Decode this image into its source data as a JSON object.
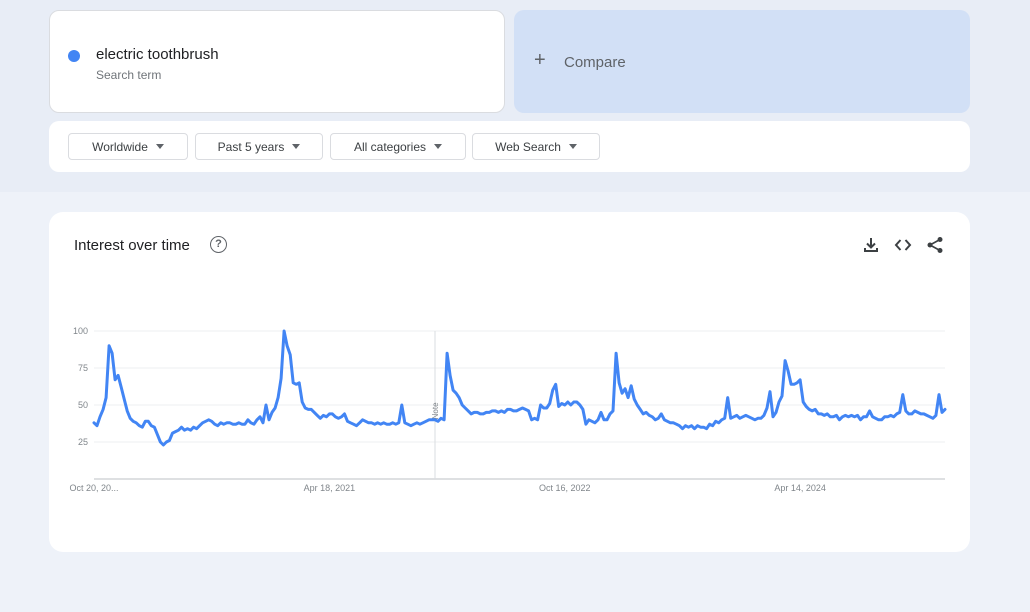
{
  "search": {
    "term": "electric toothbrush",
    "term_sublabel": "Search term",
    "term_color": "#4285f4",
    "compare_icon": "plus-icon",
    "compare_label": "Compare"
  },
  "filters": [
    {
      "label": "Worldwide"
    },
    {
      "label": "Past 5 years"
    },
    {
      "label": "All categories"
    },
    {
      "label": "Web Search"
    }
  ],
  "chart_card": {
    "title": "Interest over time",
    "help_icon": "help-circle-icon",
    "tools": [
      "download-icon",
      "embed-code-icon",
      "share-icon"
    ]
  },
  "chart_data": {
    "type": "line",
    "title": "",
    "xlabel": "",
    "ylabel": "",
    "ylim": [
      0,
      100
    ],
    "yticks": [
      25,
      50,
      75,
      100
    ],
    "xtick_labels": [
      "Oct 20, 20...",
      "Apr 18, 2021",
      "Oct 16, 2022",
      "Apr 14, 2024"
    ],
    "xtick_indices": [
      0,
      78,
      156,
      234
    ],
    "note_label": "Note",
    "note_index": 113,
    "grid": true,
    "series": [
      {
        "color": "#4285f4",
        "values": [
          38,
          36,
          42,
          47,
          55,
          90,
          85,
          67,
          70,
          62,
          54,
          46,
          41,
          39,
          38,
          36,
          35,
          39,
          39,
          36,
          35,
          30,
          25,
          23,
          25,
          26,
          31,
          32,
          33,
          35,
          33,
          34,
          33,
          35,
          34,
          36,
          38,
          39,
          40,
          39,
          37,
          36,
          38,
          37,
          38,
          38,
          37,
          37,
          38,
          37,
          37,
          40,
          38,
          37,
          40,
          42,
          38,
          50,
          40,
          45,
          48,
          55,
          68,
          100,
          90,
          84,
          65,
          64,
          65,
          52,
          48,
          47,
          47,
          45,
          43,
          41,
          43,
          42,
          44,
          44,
          42,
          41,
          42,
          44,
          39,
          38,
          37,
          36,
          38,
          40,
          39,
          38,
          38,
          37,
          38,
          37,
          38,
          37,
          37,
          38,
          37,
          38,
          50,
          38,
          37,
          36,
          37,
          38,
          37,
          38,
          39,
          40,
          40,
          40,
          39,
          41,
          40,
          85,
          70,
          60,
          58,
          55,
          50,
          48,
          46,
          44,
          45,
          45,
          44,
          44,
          45,
          45,
          46,
          46,
          45,
          46,
          45,
          47,
          47,
          46,
          46,
          47,
          48,
          47,
          46,
          40,
          41,
          40,
          50,
          48,
          48,
          51,
          60,
          64,
          49,
          51,
          50,
          52,
          50,
          52,
          52,
          50,
          47,
          37,
          40,
          39,
          38,
          40,
          45,
          40,
          40,
          44,
          46,
          85,
          65,
          58,
          61,
          55,
          63,
          54,
          50,
          47,
          44,
          45,
          43,
          42,
          40,
          41,
          44,
          40,
          39,
          38,
          38,
          37,
          36,
          34,
          36,
          35,
          36,
          34,
          36,
          35,
          35,
          34,
          37,
          36,
          39,
          38,
          40,
          41,
          55,
          41,
          42,
          43,
          41,
          42,
          43,
          42,
          41,
          40,
          41,
          41,
          43,
          48,
          59,
          42,
          45,
          52,
          56,
          80,
          73,
          64,
          64,
          65,
          67,
          52,
          49,
          47,
          46,
          47,
          44,
          44,
          43,
          44,
          42,
          42,
          43,
          40,
          42,
          43,
          42,
          43,
          42,
          43,
          40,
          42,
          42,
          46,
          42,
          41,
          40,
          40,
          42,
          42,
          43,
          42,
          44,
          45,
          57,
          46,
          44,
          44,
          46,
          45,
          44,
          44,
          43,
          42,
          41,
          43,
          57,
          45,
          47
        ]
      }
    ]
  }
}
